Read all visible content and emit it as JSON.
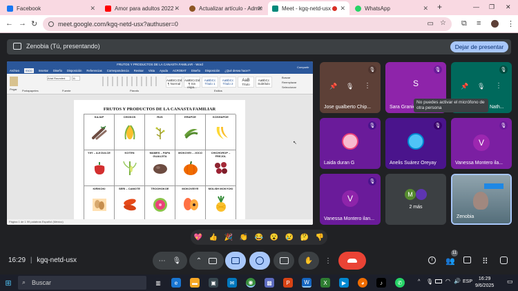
{
  "browser": {
    "tabs": [
      {
        "label": "Facebook",
        "color": "#1877f2"
      },
      {
        "label": "Amor para adultos 2022 - Y",
        "color": "#ff0000"
      },
      {
        "label": "Actualizar artículo - Admin",
        "color": "#8d5524"
      },
      {
        "label": "Meet - kgq-netd-usx",
        "color": "#00897b"
      },
      {
        "label": "WhatsApp",
        "color": "#25d366"
      }
    ],
    "new_tab": "+",
    "url": "meet.google.com/kgq-netd-usx?authuser=0"
  },
  "presenting": {
    "label": "Zenobia (Tú, presentando)",
    "stop_button": "Dejar de presentar"
  },
  "word": {
    "title": "FRUTOS Y PRODUCTOS DE LA CANASTA FAMILIAR  -  Word",
    "tabs": [
      "Archivo",
      "Inicio",
      "Insertar",
      "Diseño",
      "Disposición",
      "Referencias",
      "Correspondencia",
      "Revisar",
      "Vista",
      "Ayuda",
      "ACROBAT",
      "Diseño",
      "Disposición",
      "¿Qué desea hacer?"
    ],
    "font_name": "Arial Rounded",
    "font_size": "11",
    "styles": [
      "AaBbCcDd",
      "AaBbCcDd",
      "AaBbCc",
      "AaBbCc",
      "AaB",
      "AaBbCc",
      "AaBbCcD"
    ],
    "style_names": [
      "¶ Normal",
      "¶ Sin espa...",
      "Título 1",
      "Título 2",
      "Título",
      "Subtítulo",
      "Énfasis sutil"
    ],
    "ribbon_groups": [
      "Pegar",
      "Portapapeles",
      "Fuente",
      "Párrafo",
      "Estilos",
      "Buscar",
      "Reemplazar",
      "Seleccionar",
      "Compartir"
    ],
    "doc_title": "FRUTOS Y PRODUCTOS DE LA CANASTA FAMILIAR",
    "cells": [
      "KAJAP",
      "CHOKOS",
      "RUS",
      "ERAPOE",
      "KOSHAPOE",
      "YIIY – AJI DULCE",
      "KOTEN",
      "MAMES – PAPA GUAUJITA",
      "MOKOVEI – JOCO",
      "CHICHOROP – FREJOL",
      "KIRIKOKI",
      "SERI – CAMOTE",
      "TROOHOKOE",
      "MOKOVEIYE",
      "MOLISH MOKYOKI"
    ],
    "status": "Página 1 de 1     99 palabras     Español (México)"
  },
  "participants": [
    {
      "name": "Jose gualberto Chip...",
      "initial": "",
      "bg": "#5d4037"
    },
    {
      "name": "Sara Granie",
      "initial": "S",
      "bg": "#8e24aa"
    },
    {
      "name": "Nath...",
      "initial": "",
      "bg": "#00695c"
    },
    {
      "name": "Laida duran G",
      "initial": "",
      "bg": "#6a1b9a"
    },
    {
      "name": "Anelis Suárez Oreyay",
      "initial": "",
      "bg": "#4a148c"
    },
    {
      "name": "Vanessa Montero ila...",
      "initial": "V",
      "bg": "#7b1fa2"
    },
    {
      "name": "Vanessa Montero ilan...",
      "initial": "V",
      "bg": "#6a1b9a"
    },
    {
      "name": "2 más",
      "initial": "M",
      "bg": "#3c4043"
    },
    {
      "name": "Zenobia",
      "initial": "",
      "bg": "#37474f"
    }
  ],
  "tooltip": "No puedes activar el micrófono de otra persona",
  "reactions": [
    "💖",
    "👍",
    "🎉",
    "👏",
    "😂",
    "😮",
    "😢",
    "🤔",
    "👎"
  ],
  "controls": {
    "time": "16:29",
    "meeting_code": "kgq-netd-usx",
    "participant_count": "11"
  },
  "taskbar": {
    "search": "Buscar",
    "lang": "ESP",
    "time": "16:29",
    "date": "9/6/2025"
  }
}
